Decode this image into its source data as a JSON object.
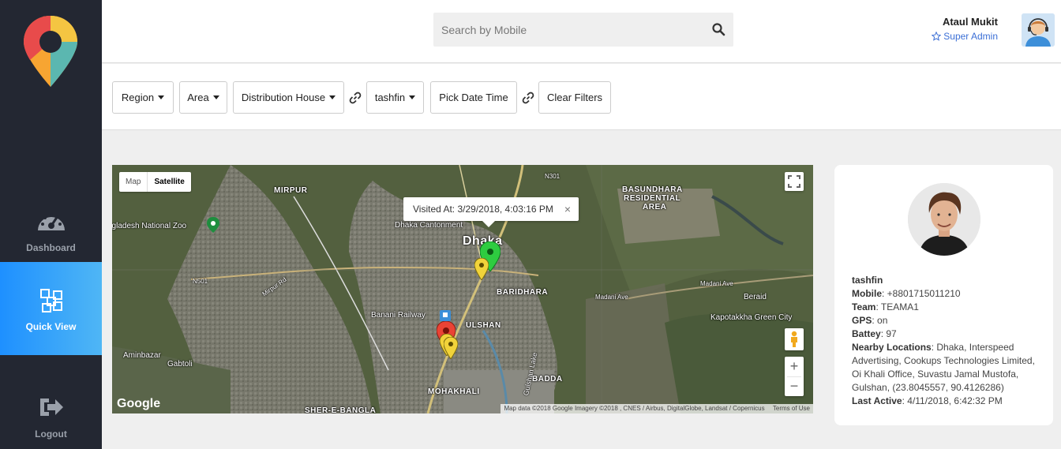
{
  "sidebar": {
    "items": [
      {
        "label": "Dashboard",
        "icon": "speedometer-icon"
      },
      {
        "label": "Quick View",
        "icon": "cubes-icon",
        "active": true
      },
      {
        "label": "Logout",
        "icon": "sign-out-icon"
      }
    ]
  },
  "header": {
    "search_placeholder": "Search by Mobile",
    "user_name": "Ataul Mukit",
    "user_role": "Super Admin"
  },
  "filters": {
    "region": "Region",
    "area": "Area",
    "distribution_house": "Distribution House",
    "user": "tashfin",
    "pick_date": "Pick Date Time",
    "clear": "Clear Filters"
  },
  "map": {
    "type_map": "Map",
    "type_satellite": "Satellite",
    "tooltip": "Visited At: 3/29/2018, 4:03:16 PM",
    "close": "×",
    "zoom_in": "+",
    "zoom_out": "−",
    "google": "Google",
    "attribution": "Map data ©2018 Google Imagery ©2018 , CNES / Airbus, DigitalGlobe, Landsat / Copernicus",
    "terms": "Terms of Use",
    "labels": {
      "mirpur": "MIRPUR",
      "zoo": "ngladesh National Zoo",
      "cantonment": "Dhaka Cantonment",
      "dhaka": "Dhaka",
      "baridhara": "BARIDHARA",
      "basundhara1": "BASUNDHARA",
      "basundhara2": "RESIDENTIAL",
      "basundhara3": "AREA",
      "banani": "Banani Railway",
      "gulshan": "ULSHAN",
      "badda": "BADDA",
      "mohakhali": "MOHAKHALI",
      "aminbazar": "Aminbazar",
      "gabtoli": "Gabtoli",
      "sherebangla": "SHER-E-BANGLA",
      "beraid": "Beraid",
      "kapotakkha": "Kapotakkha Green City",
      "n301": "N301",
      "n501": "N501",
      "mirpur_rd": "Mirpur Rd",
      "madani": "Madani Ave",
      "madani2": "Madani Ave",
      "gulshan_lake": "Gulshan Lake"
    }
  },
  "profile": {
    "name": "tashfin",
    "mobile_label": "Mobile",
    "mobile": "+8801715011210",
    "team_label": "Team",
    "team": "TEAMA1",
    "gps_label": "GPS",
    "gps": "on",
    "battery_label": "Battey",
    "battery": "97",
    "nearby_label": "Nearby Locations",
    "nearby": "Dhaka, Interspeed Advertising, Cookups Technologies Limited, Oi Khali Office, Suvastu Jamal Mustofa, Gulshan, (23.8045557, 90.4126286)",
    "last_active_label": "Last Active",
    "last_active": "4/11/2018, 6:42:32 PM"
  },
  "colors": {
    "sidebar_bg": "#232732",
    "accent": "#1e90ff",
    "marker_green": "#2ecc40",
    "marker_yellow": "#f1d33a",
    "marker_red": "#ea4335"
  }
}
